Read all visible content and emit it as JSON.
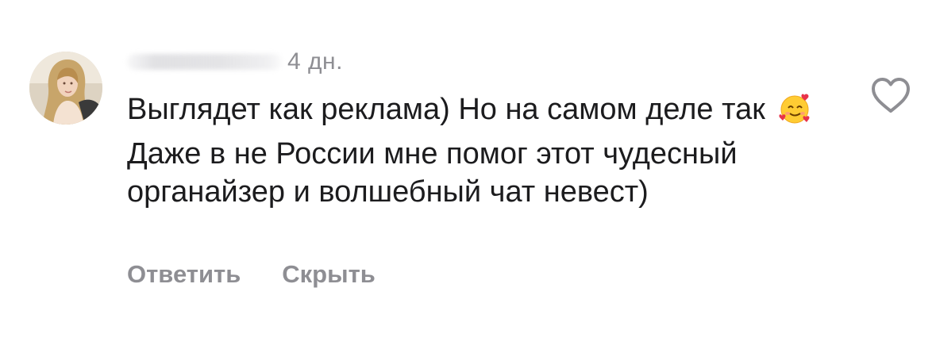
{
  "comment": {
    "timestamp": "4 дн.",
    "text_before_emoji": "Выглядет как реклама) Но на самом деле так",
    "text_after_emoji": "Даже в не России мне помог этот чудесный органайзер и волшебный чат невест)",
    "emoji_icon": "smiling-face-with-hearts-icon",
    "like_icon": "heart-outline-icon"
  },
  "actions": {
    "reply_label": "Ответить",
    "hide_label": "Скрыть"
  },
  "colors": {
    "text": "#1c1c1e",
    "secondary": "#8e8e93"
  }
}
